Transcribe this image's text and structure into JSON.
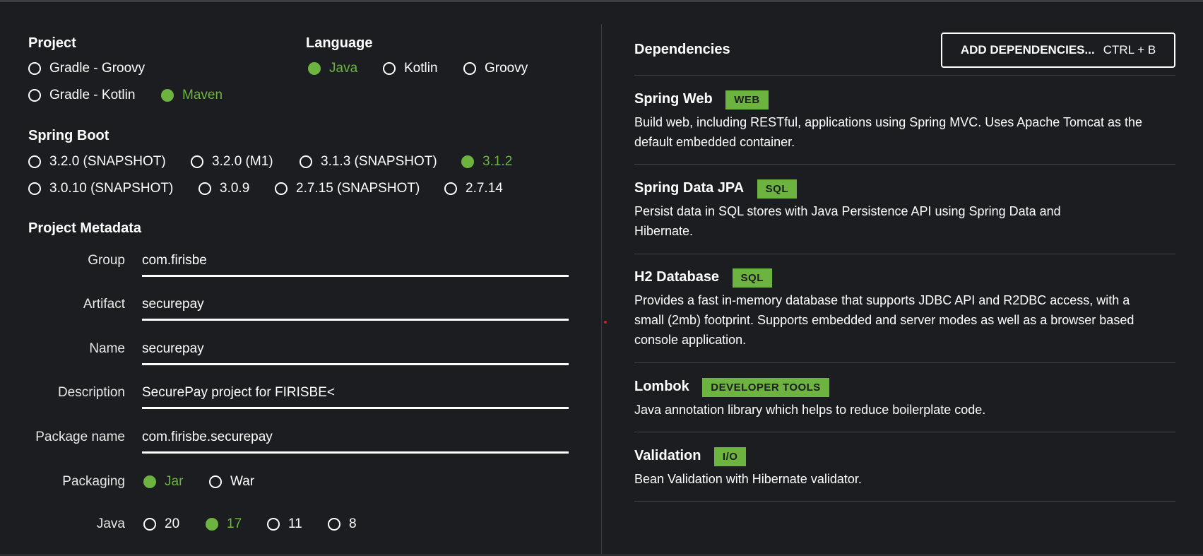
{
  "project": {
    "title": "Project",
    "options": [
      "Gradle - Groovy",
      "Gradle - Kotlin",
      "Maven"
    ],
    "selected": "Maven"
  },
  "language": {
    "title": "Language",
    "options": [
      "Java",
      "Kotlin",
      "Groovy"
    ],
    "selected": "Java"
  },
  "spring_boot": {
    "title": "Spring Boot",
    "options": [
      "3.2.0 (SNAPSHOT)",
      "3.2.0 (M1)",
      "3.1.3 (SNAPSHOT)",
      "3.1.2",
      "3.0.10 (SNAPSHOT)",
      "3.0.9",
      "2.7.15 (SNAPSHOT)",
      "2.7.14"
    ],
    "selected": "3.1.2"
  },
  "metadata": {
    "title": "Project Metadata",
    "group": {
      "label": "Group",
      "value": "com.firisbe"
    },
    "artifact": {
      "label": "Artifact",
      "value": "securepay"
    },
    "name": {
      "label": "Name",
      "value": "securepay"
    },
    "description": {
      "label": "Description",
      "value": "SecurePay project for FIRISBE<"
    },
    "package_name": {
      "label": "Package name",
      "value": "com.firisbe.securepay"
    },
    "packaging": {
      "label": "Packaging",
      "options": [
        "Jar",
        "War"
      ],
      "selected": "Jar"
    },
    "java": {
      "label": "Java",
      "options": [
        "20",
        "17",
        "11",
        "8"
      ],
      "selected": "17"
    }
  },
  "dependencies": {
    "title": "Dependencies",
    "add_button": {
      "label": "ADD DEPENDENCIES...",
      "shortcut": "CTRL + B"
    },
    "items": [
      {
        "name": "Spring Web",
        "tag": "WEB",
        "description": "Build web, including RESTful, applications using Spring MVC. Uses Apache Tomcat as the default embedded container."
      },
      {
        "name": "Spring Data JPA",
        "tag": "SQL",
        "description": "Persist data in SQL stores with Java Persistence API using Spring Data and Hibernate."
      },
      {
        "name": "H2 Database",
        "tag": "SQL",
        "description": "Provides a fast in-memory database that supports JDBC API and R2DBC access, with a small (2mb) footprint. Supports embedded and server modes as well as a browser based console application."
      },
      {
        "name": "Lombok",
        "tag": "DEVELOPER TOOLS",
        "description": "Java annotation library which helps to reduce boilerplate code."
      },
      {
        "name": "Validation",
        "tag": "I/O",
        "description": "Bean Validation with Hibernate validator."
      }
    ]
  },
  "colors": {
    "accent": "#6db33f",
    "background": "#1b1d21",
    "text": "#ffffff"
  }
}
